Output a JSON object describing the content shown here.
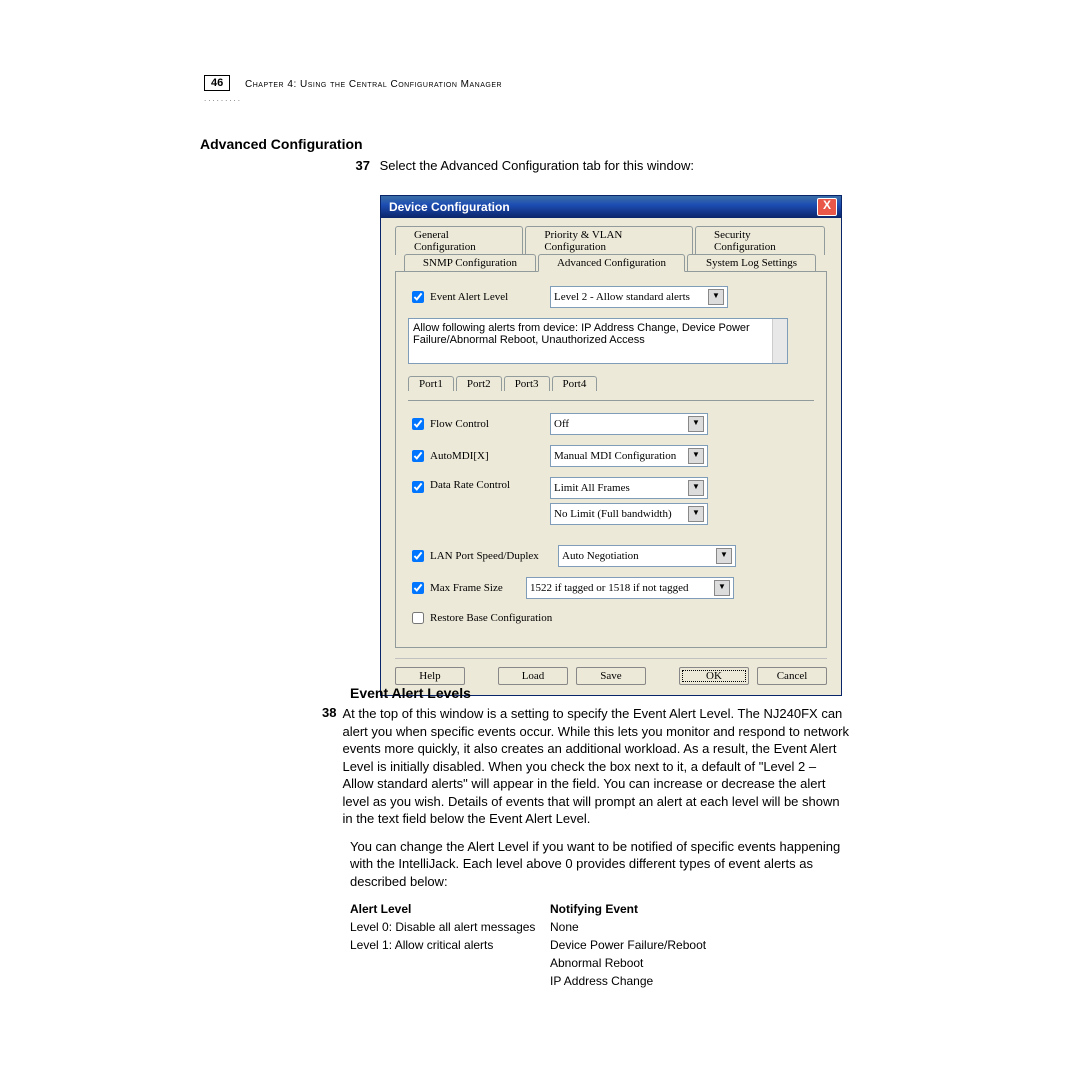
{
  "pagenum": "46",
  "chapterline": "Chapter 4: Using the Central Configuration Manager",
  "h1": "Advanced Configuration",
  "step37_num": "37",
  "step37_text": "Select the Advanced Configuration tab for this window:",
  "dialog": {
    "title": "Device Configuration",
    "close": "X",
    "tabs_row1": [
      "General Configuration",
      "Priority & VLAN Configuration",
      "Security Configuration"
    ],
    "tabs_row2": [
      "SNMP Configuration",
      "Advanced Configuration",
      "System Log Settings"
    ],
    "event_alert_label": "Event Alert Level",
    "event_alert_value": "Level 2 - Allow standard alerts",
    "alert_textarea": "Allow following alerts from device: IP Address Change, Device Power Failure/Abnormal Reboot, Unauthorized Access",
    "port_tabs": [
      "Port1",
      "Port2",
      "Port3",
      "Port4"
    ],
    "flow_control_label": "Flow Control",
    "flow_control_value": "Off",
    "automdi_label": "AutoMDI[X]",
    "automdi_value": "Manual MDI Configuration",
    "datarate_label": "Data Rate Control",
    "datarate_value1": "Limit All Frames",
    "datarate_value2": "No Limit (Full bandwidth)",
    "lanport_label": "LAN Port Speed/Duplex",
    "lanport_value": "Auto Negotiation",
    "maxframe_label": "Max Frame Size",
    "maxframe_value": "1522 if tagged or 1518 if not tagged",
    "restore_label": "Restore Base Configuration",
    "btn_help": "Help",
    "btn_load": "Load",
    "btn_save": "Save",
    "btn_ok": "OK",
    "btn_cancel": "Cancel"
  },
  "h2": "Event Alert Levels",
  "step38_num": "38",
  "para1": "At the top of this window is a setting to specify the Event Alert Level. The NJ240FX can alert you when specific events occur. While this lets you monitor and respond to network events more quickly, it also creates an additional workload. As a result, the Event Alert Level is initially disabled.  When you check the box next to it, a default of \"Level 2 – Allow standard alerts\" will appear in the field.  You can increase or decrease the alert level as you wish.  Details of events that will prompt an alert at each level will be shown in the text field below the Event Alert Level.",
  "para2": "You can change the Alert Level if you want to be notified of specific events happening with the IntelliJack. Each level above 0 provides different types of event alerts as described below:",
  "table": {
    "h1": "Alert Level",
    "h2": "Notifying Event",
    "r1c1": "Level 0: Disable all alert messages",
    "r1c2": "None",
    "r2c1": "Level 1: Allow critical alerts",
    "r2c2a": "Device Power Failure/Reboot",
    "r2c2b": "Abnormal Reboot",
    "r2c2c": "IP Address Change"
  }
}
